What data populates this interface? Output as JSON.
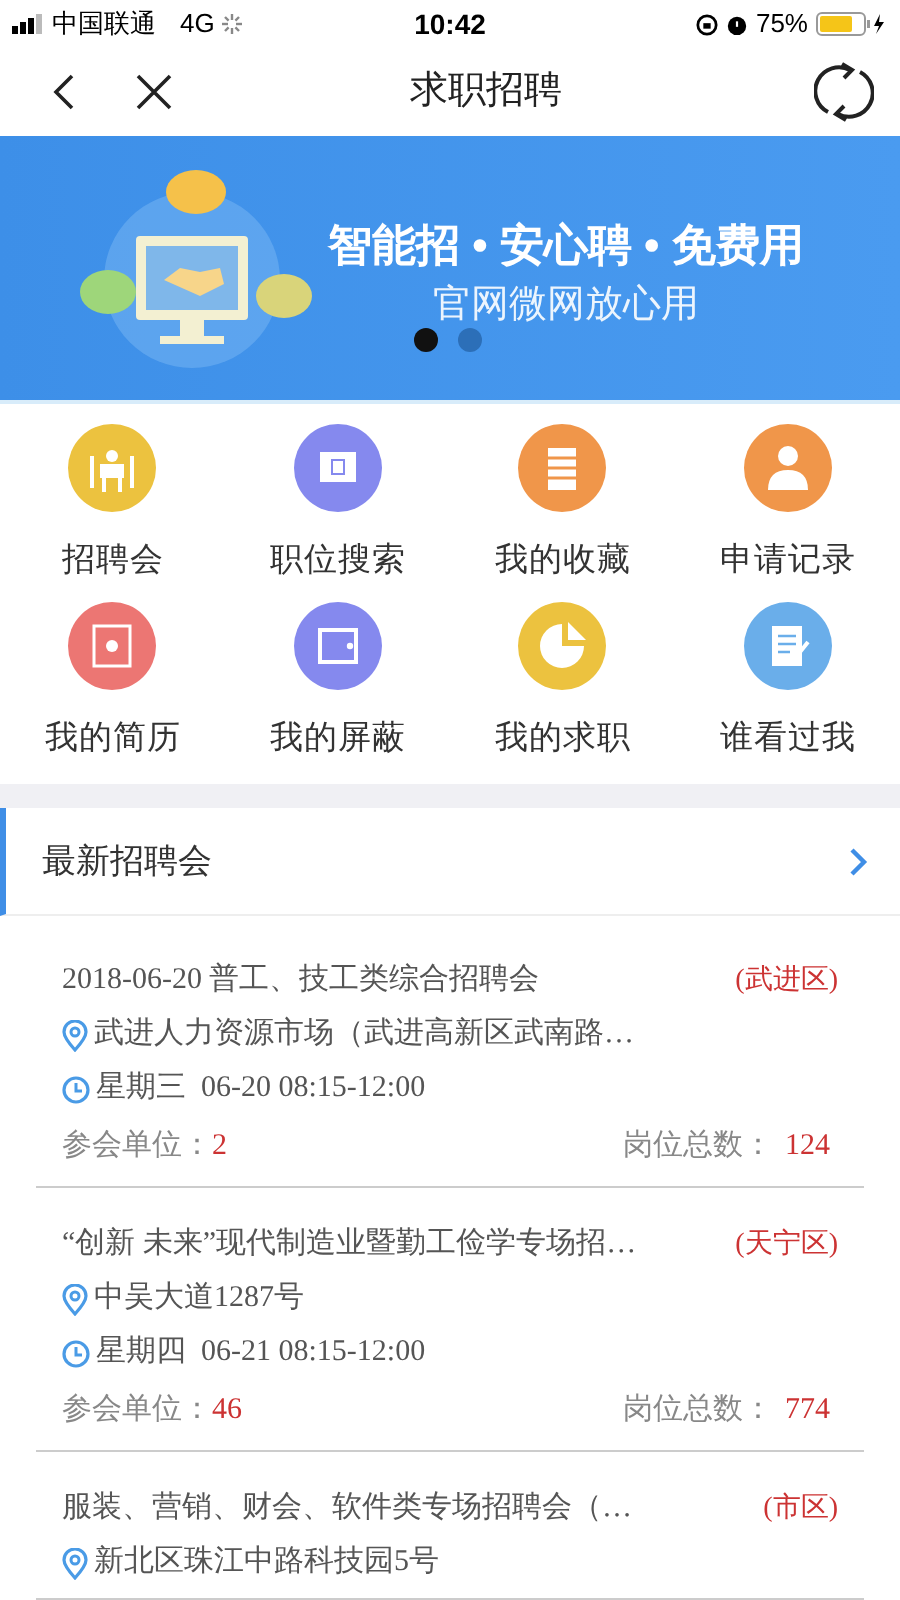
{
  "status_bar": {
    "carrier": "中国联通",
    "network": "4G",
    "time": "10:42",
    "battery": "75%"
  },
  "nav": {
    "title": "求职招聘"
  },
  "banner": {
    "headline": "智能招 • 安心聘 • 免费用",
    "subtitle": "官网微网放心用",
    "dots": [
      {
        "selected": true
      },
      {
        "selected": false
      }
    ]
  },
  "shortcuts": [
    {
      "label": "招聘会",
      "color": "#ecc23f"
    },
    {
      "label": "职位搜索",
      "color": "#8589ee"
    },
    {
      "label": "我的收藏",
      "color": "#f0964a"
    },
    {
      "label": "申请记录",
      "color": "#f0964a"
    },
    {
      "label": "我的简历",
      "color": "#ec7673"
    },
    {
      "label": "我的屏蔽",
      "color": "#8589ee"
    },
    {
      "label": "我的求职",
      "color": "#ecc23f"
    },
    {
      "label": "谁看过我",
      "color": "#6aaeea"
    }
  ],
  "section": {
    "title": "最新招聘会"
  },
  "fairs": [
    {
      "title": "2018-06-20 普工、技工类综合招聘会",
      "district": "(武进区)",
      "address": "武进人力资源市场（武进高新区武南路…",
      "time": "星期三  06-20 08:15-12:00",
      "units_label": "参会单位：",
      "units": "2",
      "positions_label": "岗位总数：",
      "positions": "124"
    },
    {
      "title": "“创新 未来”现代制造业暨勤工俭学专场招…",
      "district": "(天宁区)",
      "address": "中吴大道1287号",
      "time": "星期四  06-21 08:15-12:00",
      "units_label": "参会单位：",
      "units": "46",
      "positions_label": "岗位总数：",
      "positions": "774"
    },
    {
      "title": "服装、营销、财会、软件类专场招聘会（…",
      "district": "(市区)",
      "address": "新北区珠江中路科技园5号"
    }
  ]
}
